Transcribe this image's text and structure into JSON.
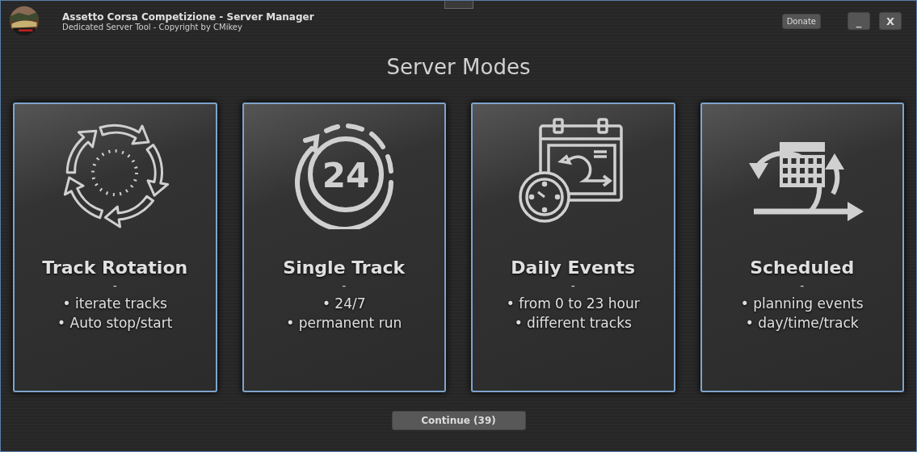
{
  "window": {
    "title": "Assetto Corsa Competizione - Server Manager",
    "subtitle": "Dedicated Server Tool - Copyright by CMikey",
    "buttons": [
      "Donate",
      "_",
      "X"
    ]
  },
  "heading": "Server Modes",
  "modes": [
    {
      "kind": "rotation",
      "title": "Track Rotation",
      "separator": "-",
      "lines": [
        "• iterate tracks",
        "• Auto stop/start"
      ]
    },
    {
      "kind": "single",
      "badge": "24",
      "title": "Single Track",
      "separator": "-",
      "lines": [
        "• 24/7",
        "• permanent run"
      ]
    },
    {
      "kind": "daily",
      "title": "Daily Events",
      "separator": "-",
      "lines": [
        "• from 0 to 23 hour",
        "• different tracks"
      ]
    },
    {
      "kind": "scheduled",
      "title": "Scheduled",
      "separator": "-",
      "lines": [
        "• planning events",
        "• day/time/track"
      ]
    }
  ],
  "continue_button": "Continue (39)"
}
